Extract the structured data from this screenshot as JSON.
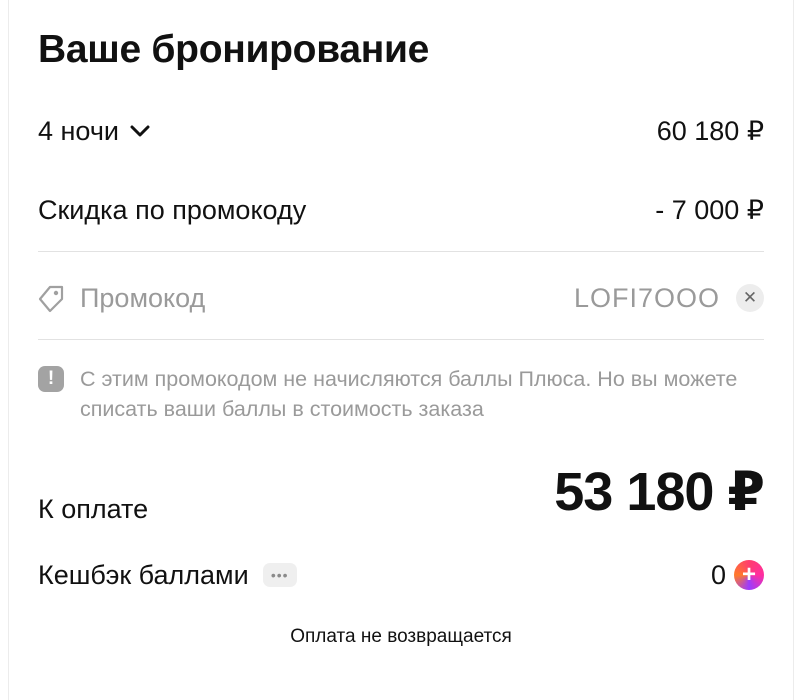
{
  "booking": {
    "title": "Ваше бронирование",
    "nights_label": "4 ночи",
    "nights_price": "60 180 ₽",
    "discount_label": "Скидка по промокоду",
    "discount_value": "- 7 000 ₽"
  },
  "promo": {
    "label": "Промокод",
    "code": "LOFI7OOO",
    "clear_symbol": "✕"
  },
  "notice": {
    "icon_symbol": "!",
    "text": "С этим промокодом не начисляются баллы Плюса. Но вы можете списать ваши баллы в стоимость заказа"
  },
  "payment": {
    "label": "К оплате",
    "amount": "53 180 ₽"
  },
  "cashback": {
    "label": "Кешбэк баллами",
    "more_symbol": "•••",
    "value": "0",
    "plus_symbol": "+"
  },
  "footer": {
    "refund_note": "Оплата не возвращается"
  },
  "icons": {
    "chevron": "chevron-down-icon",
    "tag": "promo-tag-icon",
    "info": "info-icon",
    "plus": "plus-points-icon",
    "clear": "close-icon"
  },
  "colors": {
    "text_primary": "#111111",
    "text_muted": "#9a9a9a",
    "divider": "#e2e2e2",
    "plus_gradient": [
      "#ff3d6e",
      "#9b3bff",
      "#ff7a2a"
    ]
  }
}
